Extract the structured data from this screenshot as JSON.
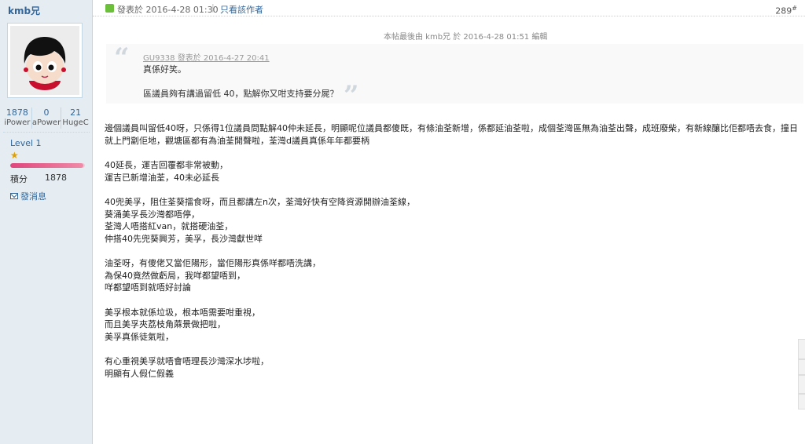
{
  "author": {
    "name": "kmb兄",
    "avatar_icon": "cartoon-avatar-icon",
    "stats": [
      {
        "value": "1878",
        "label": "iPower"
      },
      {
        "value": "0",
        "label": "aPower"
      },
      {
        "value": "21",
        "label": "HugeC"
      }
    ],
    "level": "Level 1",
    "level_progress": 0.98,
    "points_label": "積分",
    "points_value": "1878",
    "send_message": "發消息"
  },
  "post_header": {
    "posted_at": "發表於 2016-4-28 01:30",
    "separator": "|",
    "author_only": "只看該作者",
    "floor": "289",
    "floor_mark": "#"
  },
  "edited_note": "本帖最後由 kmb兄 於 2016-4-28 01:51 編輯",
  "quote": {
    "author_line": "GU9338 發表於 2016-4-27 20:41",
    "line1": "真係好笑。",
    "line2": "區議員夠有講過留低 40，點解你又咁支持要分屍？"
  },
  "body": {
    "paragraphs": [
      [
        "邊個議員叫留低40呀，只係得1位議員問點解40仲未延長，明顯呢位議員都傻既，有條油荃新增，係都延油荃啦，成個荃灣區無為油荃出聲，成班廢柴，有新線釀比佢都唔去食，撞日就上門劏佢地，觀塘區都有為油荃開聲啦，荃灣d議員真係年年都要柄"
      ],
      [
        "40延長，運吉回覆都非常被動，",
        "運吉已新增油荃，40未必延長"
      ],
      [
        "40兜美孚，阻住荃葵擂食呀，而且都講左n次，荃灣好快有空降資源開辦油荃線，",
        "葵涌美孚長沙灣都唔停，",
        "荃灣人唔搭紅van，就搭硬油荃，",
        "仲搭40先兜葵興芳，美孚，長沙灣獻世咩"
      ],
      [
        "油荃呀，有傻佬又當佢陽形，當佢陽形真係咩都唔洗講，",
        "為保40竟然做虧局，我咩都望唔到，",
        "咩都望唔到就唔好討論"
      ],
      [
        "美孚根本就係垃圾，根本唔需要咁重視，",
        "而且美孚夾荔枝角蔴景做把啦，",
        "美孚真係徒氣啦，"
      ],
      [
        "有心重視美孚就唔會唔理長沙灣深水埗啦，",
        "明顯有人假仁假義"
      ]
    ]
  }
}
